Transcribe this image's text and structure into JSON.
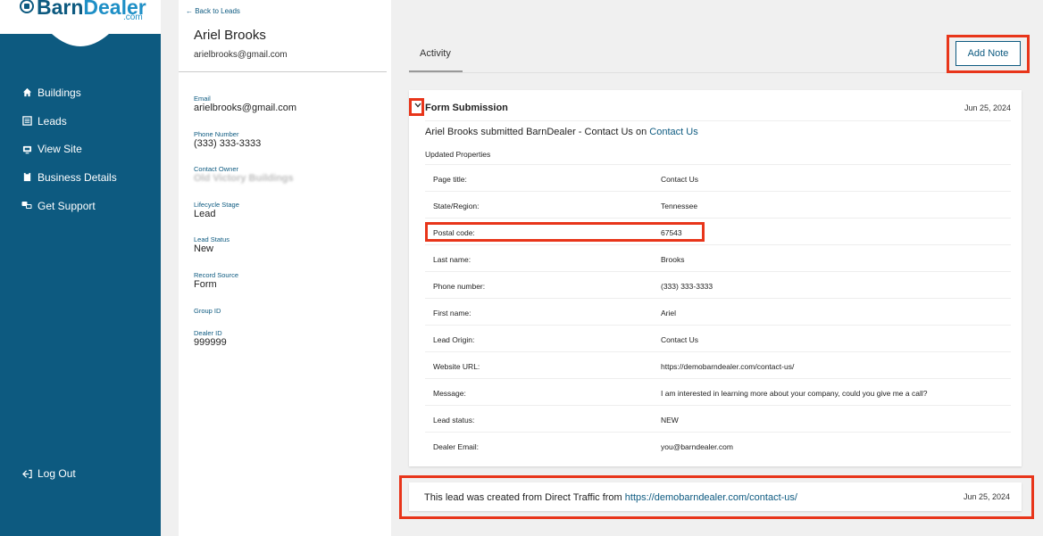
{
  "brand": {
    "name_part1": "Barn",
    "name_part2": "Dealer",
    "suffix": ".com"
  },
  "nav": {
    "items": [
      {
        "label": "Buildings",
        "icon": "house-icon"
      },
      {
        "label": "Leads",
        "icon": "list-icon"
      },
      {
        "label": "View Site",
        "icon": "monitor-icon"
      },
      {
        "label": "Business Details",
        "icon": "clipboard-icon"
      },
      {
        "label": "Get Support",
        "icon": "support-icon"
      }
    ],
    "logout": "Log Out"
  },
  "contact": {
    "back": "← Back to Leads",
    "name": "Ariel Brooks",
    "email_head": "arielbrooks@gmail.com",
    "fields": [
      {
        "label": "Email",
        "value": "arielbrooks@gmail.com"
      },
      {
        "label": "Phone Number",
        "value": "(333) 333-3333"
      },
      {
        "label": "Contact Owner",
        "value": "Old Victory Buildings"
      },
      {
        "label": "Lifecycle Stage",
        "value": "Lead"
      },
      {
        "label": "Lead Status",
        "value": "New"
      },
      {
        "label": "Record Source",
        "value": "Form"
      },
      {
        "label": "Group ID",
        "value": ""
      },
      {
        "label": "Dealer ID",
        "value": "999999"
      }
    ]
  },
  "main": {
    "tab": "Activity",
    "add_note": "Add Note",
    "form_card": {
      "title": "Form Submission",
      "date": "Jun 25, 2024",
      "summary_prefix": "Ariel Brooks submitted BarnDealer - Contact Us on ",
      "summary_link": "Contact Us",
      "updated_label": "Updated Properties",
      "properties": [
        {
          "label": "Page title:",
          "value": "Contact Us"
        },
        {
          "label": "State/Region:",
          "value": "Tennessee"
        },
        {
          "label": "Postal code:",
          "value": "67543"
        },
        {
          "label": "Last name:",
          "value": "Brooks"
        },
        {
          "label": "Phone number:",
          "value": "(333) 333-3333"
        },
        {
          "label": "First name:",
          "value": "Ariel"
        },
        {
          "label": "Lead Origin:",
          "value": "Contact Us"
        },
        {
          "label": "Website URL:",
          "value": "https://demobarndealer.com/contact-us/"
        },
        {
          "label": "Message:",
          "value": "I am interested in learning more about your company, could you give me a call?"
        },
        {
          "label": "Lead status:",
          "value": "NEW"
        },
        {
          "label": "Dealer Email:",
          "value": "you@barndealer.com"
        }
      ]
    },
    "traffic_card": {
      "text_prefix": "This lead was created from Direct Traffic from ",
      "link": "https://demobarndealer.com/contact-us/",
      "date": "Jun 25, 2024"
    }
  },
  "colors": {
    "sidebar": "#0d5a80",
    "accent": "#1e8fc6",
    "highlight": "#e8351a"
  }
}
